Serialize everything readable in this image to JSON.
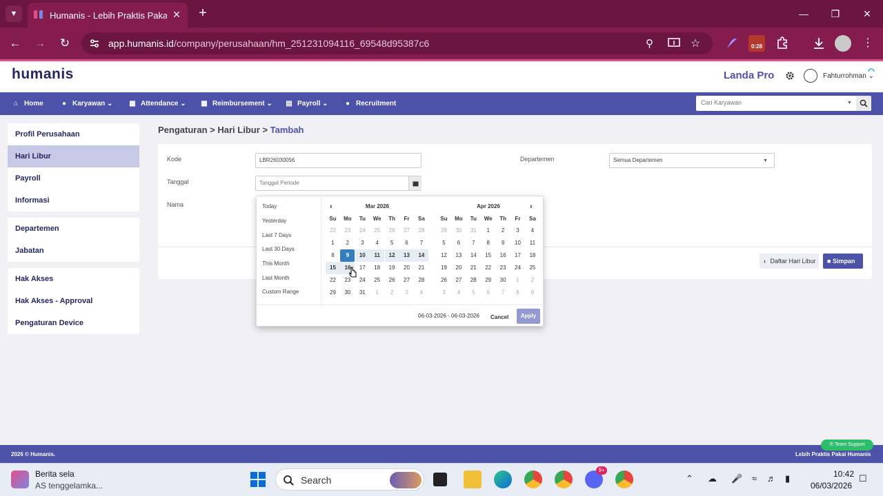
{
  "browser": {
    "tab_title": "Humanis - Lebih Praktis Pakai H",
    "url_host": "app.humanis.id",
    "url_path": "/company/perusahaan/hm_251231094116_69548d95387c6",
    "extension_badge": "0:28"
  },
  "header": {
    "logo": "humanis",
    "company": "Landa Pro",
    "user": "Fahturrohman"
  },
  "nav": {
    "items": [
      {
        "label": "Home",
        "icon": "home-icon"
      },
      {
        "label": "Karyawan",
        "icon": "users-icon"
      },
      {
        "label": "Attendance",
        "icon": "calendar-icon"
      },
      {
        "label": "Reimbursement",
        "icon": "money-icon"
      },
      {
        "label": "Payroll",
        "icon": "payroll-icon"
      },
      {
        "label": "Recruitment",
        "icon": "recruit-icon"
      }
    ],
    "search_placeholder": "Cari Karyawan"
  },
  "sidebar": {
    "group1": [
      "Profil Perusahaan",
      "Hari Libur",
      "Payroll",
      "Informasi"
    ],
    "group2": [
      "Departemen",
      "Jabatan"
    ],
    "group3": [
      "Hak Akses",
      "Hak Akses - Approval",
      "Pengaturan Device"
    ]
  },
  "breadcrumb": {
    "a": "Pengaturan",
    "b": "Hari Libur",
    "c": "Tambah",
    "sep": ">"
  },
  "form": {
    "kode_label": "Kode",
    "kode_value": "LBR26030056",
    "tanggal_label": "Tanggal",
    "tanggal_placeholder": "Tanggal Periode",
    "nama_label": "Nama",
    "departemen_label": "Departemen",
    "departemen_value": "Semua Departemen",
    "back_button": "Daftar Hari Libur",
    "save_button": "Simpan"
  },
  "datepicker": {
    "ranges": [
      "Today",
      "Yesterday",
      "Last 7 Days",
      "Last 30 Days",
      "This Month",
      "Last Month",
      "Custom Range"
    ],
    "weekdays": [
      "Su",
      "Mo",
      "Tu",
      "We",
      "Th",
      "Fr",
      "Sa"
    ],
    "left_month": "Mar 2026",
    "right_month": "Apr 2026",
    "left_days": [
      "22",
      "23",
      "24",
      "25",
      "26",
      "27",
      "28",
      "1",
      "2",
      "3",
      "4",
      "5",
      "6",
      "7",
      "8",
      "9",
      "10",
      "11",
      "12",
      "13",
      "14",
      "15",
      "16",
      "17",
      "18",
      "19",
      "20",
      "21",
      "22",
      "23",
      "24",
      "25",
      "26",
      "27",
      "28",
      "29",
      "30",
      "31",
      "1",
      "2",
      "3",
      "4"
    ],
    "right_days": [
      "29",
      "30",
      "31",
      "1",
      "2",
      "3",
      "4",
      "5",
      "6",
      "7",
      "8",
      "9",
      "10",
      "11",
      "12",
      "13",
      "14",
      "15",
      "16",
      "17",
      "18",
      "19",
      "20",
      "21",
      "22",
      "23",
      "24",
      "25",
      "26",
      "27",
      "28",
      "29",
      "30",
      "1",
      "2",
      "3",
      "4",
      "5",
      "6",
      "7",
      "8",
      "9"
    ],
    "range_text": "06-03-2026 - 06-03-2026",
    "cancel": "Cancel",
    "apply": "Apply"
  },
  "footer": {
    "left": "2026 © Humanis.",
    "right": "Lebih Praktis Pakai Humanis",
    "support": "Team Support"
  },
  "taskbar": {
    "news_title": "Berita sela",
    "news_sub": "AS tenggelamka...",
    "search": "Search",
    "time": "10:42",
    "date": "06/03/2026",
    "discord_badge": "9+"
  }
}
